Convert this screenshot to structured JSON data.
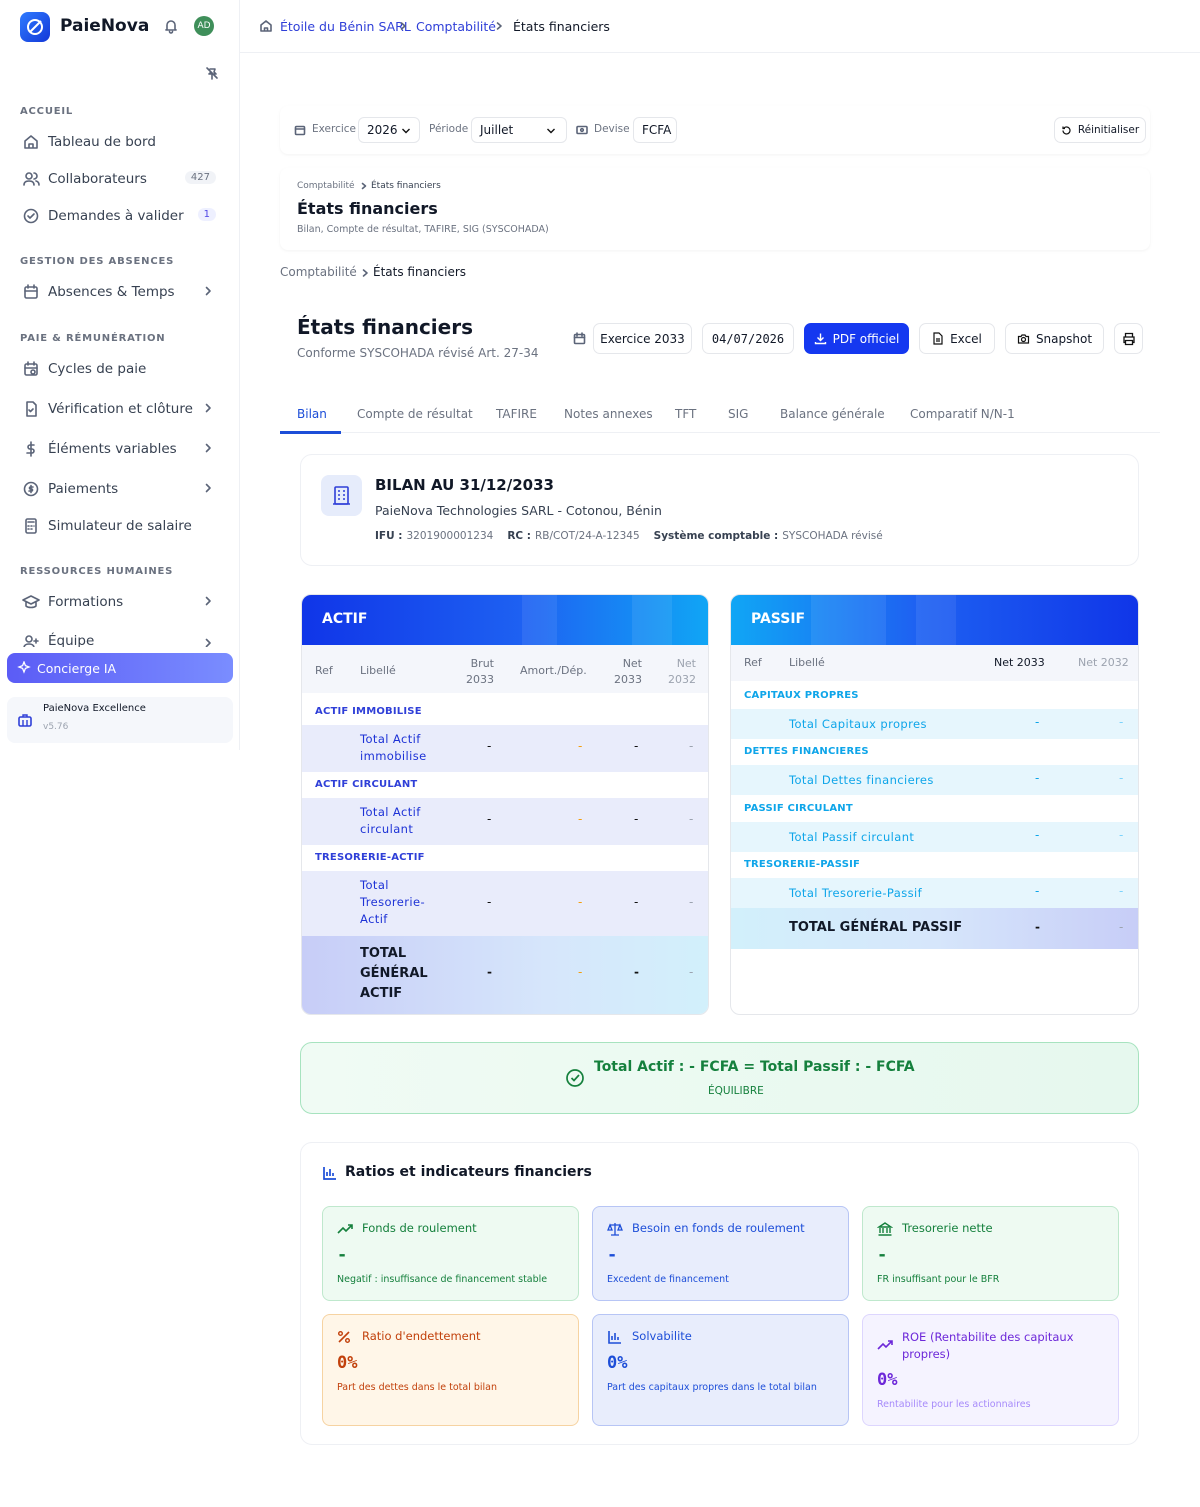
{
  "app": {
    "name": "PaieNova",
    "avatar": "AD",
    "version_name": "PaieNova Excellence",
    "version": "v5.76"
  },
  "sidebar": {
    "sections": [
      "ACCUEIL",
      "GESTION DES ABSENCES",
      "PAIE & RÉMUNÉRATION",
      "RESSOURCES HUMAINES"
    ],
    "items": [
      {
        "label": "Tableau de bord",
        "icon": "home-icon"
      },
      {
        "label": "Collaborateurs",
        "icon": "users-icon",
        "badge": "427"
      },
      {
        "label": "Demandes à valider",
        "icon": "check-circle-icon",
        "badge": "1"
      },
      {
        "label": "Absences & Temps",
        "icon": "calendar-icon"
      },
      {
        "label": "Cycles de paie",
        "icon": "calendar-clock-icon"
      },
      {
        "label": "Vérification et clôture",
        "icon": "file-check-icon"
      },
      {
        "label": "Éléments variables",
        "icon": "dollar-icon"
      },
      {
        "label": "Paiements",
        "icon": "coin-icon"
      },
      {
        "label": "Simulateur de salaire",
        "icon": "calculator-icon"
      },
      {
        "label": "Formations",
        "icon": "graduation-cap-icon"
      },
      {
        "label": "Équipe",
        "icon": "user-plus-icon"
      }
    ],
    "concierge": "Concierge IA"
  },
  "breadcrumb": {
    "company": "Étoile du Bénin SARL",
    "section": "Comptabilité",
    "page": "États financiers"
  },
  "filters": {
    "exercise_label": "Exercice",
    "exercise_value": "2026",
    "period_label": "Période",
    "period_value": "Juillet",
    "currency_label": "Devise",
    "currency_value": "FCFA",
    "reset": "Réinitialiser"
  },
  "header_card": {
    "crumb1": "Comptabilité",
    "crumb2": "États financiers",
    "title": "États financiers",
    "subtitle": "Bilan, Compte de résultat, TAFIRE, SIG (SYSCOHADA)"
  },
  "crumb2": {
    "a": "Comptabilité",
    "b": "États financiers"
  },
  "page": {
    "title": "États financiers",
    "subtitle": "Conforme SYSCOHADA révisé Art. 27-34",
    "exercise": "Exercice 2033",
    "date": "04/07/2026",
    "pdf": "PDF officiel",
    "excel": "Excel",
    "snapshot": "Snapshot"
  },
  "tabs": [
    "Bilan",
    "Compte de résultat",
    "TAFIRE",
    "Notes annexes",
    "TFT",
    "SIG",
    "Balance générale",
    "Comparatif N/N-1"
  ],
  "bilan": {
    "title": "BILAN AU 31/12/2033",
    "company": "PaieNova Technologies SARL - Cotonou, Bénin",
    "ifu_label": "IFU :",
    "ifu": "3201900001234",
    "rc_label": "RC :",
    "rc": "RB/COT/24-A-12345",
    "sys_label": "Système comptable :",
    "sys": "SYSCOHADA révisé"
  },
  "actif": {
    "title": "ACTIF",
    "headers": {
      "ref": "Ref",
      "lib": "Libellé",
      "brut": "Brut 2033",
      "amort": "Amort./Dép.",
      "net": "Net 2033",
      "net_prev": "Net 2032"
    },
    "groups": [
      "ACTIF IMMOBILISE",
      "ACTIF CIRCULANT",
      "TRESORERIE-ACTIF"
    ],
    "rows": [
      {
        "label": "Total Actif immobilise",
        "brut": "-",
        "amort": "-",
        "net": "-",
        "prev": "-"
      },
      {
        "label": "Total Actif circulant",
        "brut": "-",
        "amort": "-",
        "net": "-",
        "prev": "-"
      },
      {
        "label": "Total Tresorerie-Actif",
        "brut": "-",
        "amort": "-",
        "net": "-",
        "prev": "-"
      }
    ],
    "total": {
      "label": "TOTAL GÉNÉRAL ACTIF",
      "brut": "-",
      "amort": "-",
      "net": "-",
      "prev": "-"
    }
  },
  "passif": {
    "title": "PASSIF",
    "headers": {
      "ref": "Ref",
      "lib": "Libellé",
      "net": "Net 2033",
      "net_prev": "Net 2032"
    },
    "groups": [
      "CAPITAUX PROPRES",
      "DETTES FINANCIERES",
      "PASSIF CIRCULANT",
      "TRESORERIE-PASSIF"
    ],
    "rows": [
      {
        "label": "Total Capitaux propres",
        "net": "-",
        "prev": "-"
      },
      {
        "label": "Total Dettes financieres",
        "net": "-",
        "prev": "-"
      },
      {
        "label": "Total Passif circulant",
        "net": "-",
        "prev": "-"
      },
      {
        "label": "Total Tresorerie-Passif",
        "net": "-",
        "prev": "-"
      }
    ],
    "total": {
      "label": "TOTAL GÉNÉRAL PASSIF",
      "net": "-",
      "prev": "-"
    }
  },
  "balance": {
    "text": "Total Actif : - FCFA = Total Passif : - FCFA",
    "status": "ÉQUILIBRE"
  },
  "ratios": {
    "title": "Ratios et indicateurs financiers",
    "cards": [
      {
        "title": "Fonds de roulement",
        "value": "-",
        "sub": "Negatif : insuffisance de financement stable",
        "color": "#15803d"
      },
      {
        "title": "Besoin en fonds de roulement",
        "value": "-",
        "sub": "Excedent de financement",
        "color": "#1d4ed8"
      },
      {
        "title": "Tresorerie nette",
        "value": "-",
        "sub": "FR insuffisant pour le BFR",
        "color": "#15803d"
      },
      {
        "title": "Ratio d'endettement",
        "value": "0%",
        "sub": "Part des dettes dans le total bilan",
        "color": "#c2410c"
      },
      {
        "title": "Solvabilite",
        "value": "0%",
        "sub": "Part des capitaux propres dans le total bilan",
        "color": "#1d4ed8"
      },
      {
        "title": "ROE (Rentabilite des capitaux propres)",
        "value": "0%",
        "sub": "Rentabilite pour les actionnaires",
        "color": "#6d28d9"
      }
    ]
  }
}
